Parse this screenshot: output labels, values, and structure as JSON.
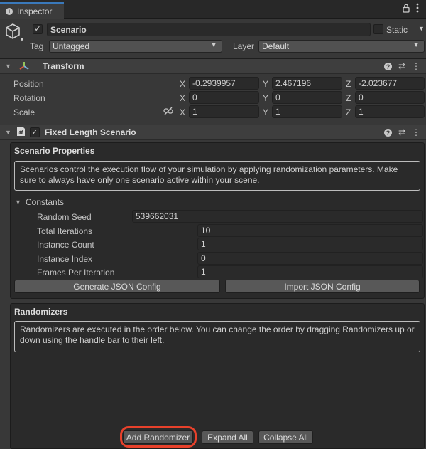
{
  "tab": {
    "title": "Inspector",
    "lock_icon": "lock-icon",
    "menu_icon": "kebab-menu-icon"
  },
  "header": {
    "object_name": "Scenario",
    "static_label": "Static",
    "tag_label": "Tag",
    "tag_value": "Untagged",
    "layer_label": "Layer",
    "layer_value": "Default"
  },
  "transform": {
    "title": "Transform",
    "rows": [
      {
        "label": "Position",
        "x": "-0.2939957",
        "y": "2.467196",
        "z": "-2.023677"
      },
      {
        "label": "Rotation",
        "x": "0",
        "y": "0",
        "z": "0"
      },
      {
        "label": "Scale",
        "x": "1",
        "y": "1",
        "z": "1"
      }
    ],
    "axes": {
      "x": "X",
      "y": "Y",
      "z": "Z"
    }
  },
  "scenario": {
    "title": "Fixed Length Scenario",
    "properties_title": "Scenario Properties",
    "properties_info": "Scenarios control the execution flow of your simulation by applying randomization parameters. Make sure to always have only one scenario active within your scene.",
    "constants_label": "Constants",
    "constants": [
      {
        "label": "Random Seed",
        "value": "539662031"
      },
      {
        "label": "Total Iterations",
        "value": "10"
      },
      {
        "label": "Instance Count",
        "value": "1"
      },
      {
        "label": "Instance Index",
        "value": "0"
      },
      {
        "label": "Frames Per Iteration",
        "value": "1"
      }
    ],
    "generate_button": "Generate JSON Config",
    "import_button": "Import JSON Config",
    "randomizers_title": "Randomizers",
    "randomizers_info": "Randomizers are executed in the order below. You can change the order by dragging Randomizers up or down using the handle bar to their left.",
    "add_button": "Add Randomizer",
    "expand_button": "Expand All",
    "collapse_button": "Collapse All"
  },
  "colors": {
    "accent_tab": "#3a79bb",
    "highlight": "#e8412b",
    "background": "#383838"
  }
}
